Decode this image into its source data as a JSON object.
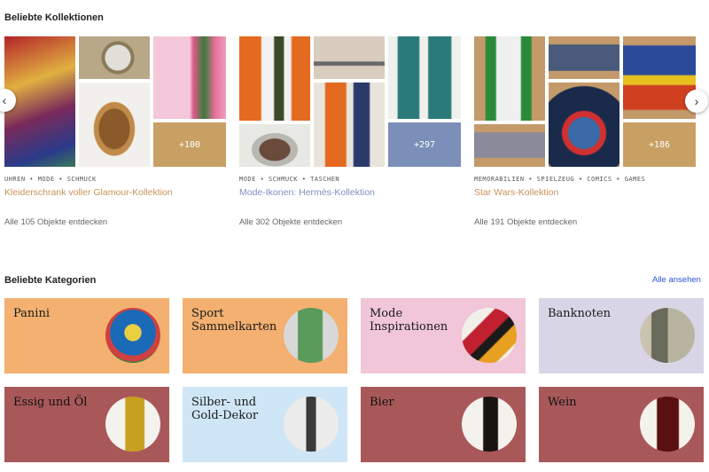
{
  "collections_heading": "Beliebte Kollektionen",
  "collections": [
    {
      "tags": "UHREN • MODE • SCHMUCK",
      "title": "Kleiderschrank voller Glamour-Kollektion",
      "more": "+100",
      "discover": "Alle 105 Objekte entdecken",
      "accent": "#c9a063",
      "title_color": "#c9925a"
    },
    {
      "tags": "MODE • SCHMUCK • TASCHEN",
      "title": "Mode-Ikonen: Hermès-Kollektion",
      "more": "+297",
      "discover": "Alle 302 Objekte entdecken",
      "accent": "#7b8fb8",
      "title_color": "#7e8fbf"
    },
    {
      "tags": "MEMORABILIEN • SPIELZEUG • COMICS • GAMES",
      "title": "Star Wars-Kollektion",
      "more": "+186",
      "discover": "Alle 191 Objekte entdecken",
      "accent": "#c9a063",
      "title_color": "#c9925a"
    }
  ],
  "carousel": {
    "prev_icon": "chevron-left-icon",
    "next_icon": "chevron-right-icon",
    "prev_glyph": "‹",
    "next_glyph": "›"
  },
  "categories_heading": "Beliebte Kategorien",
  "see_all": "Alle ansehen",
  "categories": [
    {
      "label": "Panini",
      "bg": "#f3b070"
    },
    {
      "label": "Sport\nSammelkarten",
      "bg": "#f3b070"
    },
    {
      "label": "Mode\nInspirationen",
      "bg": "#f0c6d8"
    },
    {
      "label": "Banknoten",
      "bg": "#d8d6e6"
    },
    {
      "label": "Essig und Öl",
      "bg": "#a9585a"
    },
    {
      "label": "Silber- und\nGold-Dekor",
      "bg": "#cfe6f7"
    },
    {
      "label": "Bier",
      "bg": "#a9585a"
    },
    {
      "label": "Wein",
      "bg": "#a9585a"
    }
  ]
}
